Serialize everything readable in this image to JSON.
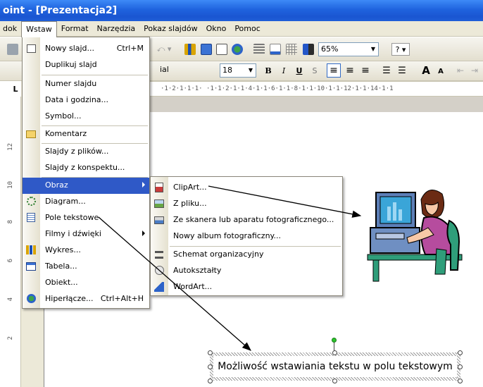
{
  "window": {
    "title": "oint - [Prezentacja2]"
  },
  "menubar": [
    "dok",
    "Wstaw",
    "Format",
    "Narzędzia",
    "Pokaz slajdów",
    "Okno",
    "Pomoc"
  ],
  "toolbar": {
    "zoom": "65%",
    "font": "ial",
    "font_size": "18",
    "bold": "B",
    "italic": "I",
    "underline": "U",
    "shadow": "S",
    "grow": "A",
    "shrink": "A"
  },
  "ruler": {
    "marks": "·1·2·1·1·1· ·1·1·2·1·1·4·1·1·6·1·1·8·1·1·10·1·1·12·1·1·14·1·1"
  },
  "vruler": [
    "12",
    "10",
    "8",
    "6",
    "4",
    "2"
  ],
  "insert_menu": {
    "items": [
      {
        "label": "Nowy slajd...",
        "shortcut": "Ctrl+M"
      },
      {
        "label": "Duplikuj slajd",
        "shortcut": ""
      },
      {
        "label": "Numer slajdu",
        "shortcut": ""
      },
      {
        "label": "Data i godzina...",
        "shortcut": ""
      },
      {
        "label": "Symbol...",
        "shortcut": ""
      },
      {
        "label": "Komentarz",
        "shortcut": ""
      },
      {
        "label": "Slajdy z plików...",
        "shortcut": ""
      },
      {
        "label": "Slajdy z konspektu...",
        "shortcut": ""
      },
      {
        "label": "Obraz",
        "shortcut": ""
      },
      {
        "label": "Diagram...",
        "shortcut": ""
      },
      {
        "label": "Pole tekstowe",
        "shortcut": ""
      },
      {
        "label": "Filmy i dźwięki",
        "shortcut": ""
      },
      {
        "label": "Wykres...",
        "shortcut": ""
      },
      {
        "label": "Tabela...",
        "shortcut": ""
      },
      {
        "label": "Obiekt...",
        "shortcut": ""
      },
      {
        "label": "Hiperłącze...",
        "shortcut": "Ctrl+Alt+H"
      }
    ]
  },
  "picture_menu": {
    "items": [
      {
        "label": "ClipArt..."
      },
      {
        "label": "Z pliku..."
      },
      {
        "label": "Ze skanera lub aparatu fotograficznego..."
      },
      {
        "label": "Nowy album fotograficzny..."
      },
      {
        "label": "Schemat organizacyjny"
      },
      {
        "label": "Autokształty"
      },
      {
        "label": "WordArt..."
      }
    ]
  },
  "slide": {
    "textbox_text": "Możliwość wstawiania tekstu w polu tekstowym"
  },
  "colors": {
    "titlebar": "#1f63de",
    "highlight": "#2f59c7",
    "menu_bg": "#ece9d8"
  }
}
